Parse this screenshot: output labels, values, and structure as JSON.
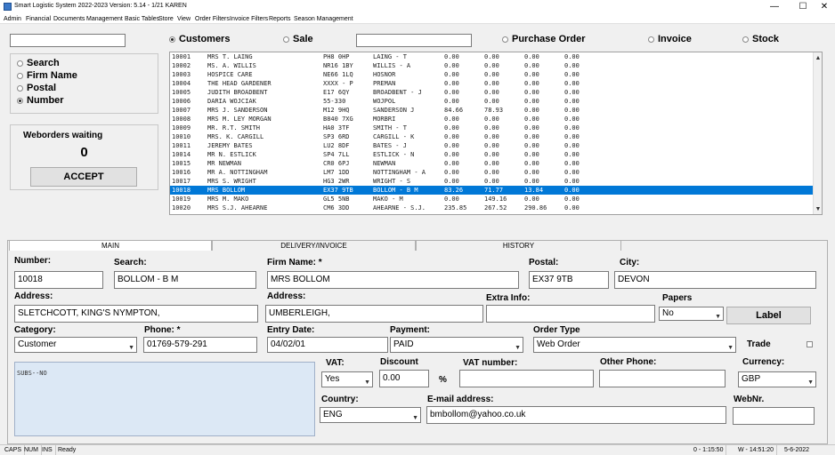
{
  "window": {
    "title": "Smart Logistic System 2022-2023   Version: 5.14 - 1/21 KAREN",
    "minimize": "—",
    "maximize": "☐",
    "close": "✕"
  },
  "menu": [
    "Admin",
    "Financial",
    "Documents",
    "Management",
    "Basic Tables",
    "Store",
    "View",
    "Order Filters",
    "Invoice Filters",
    "Reports",
    "Season Management"
  ],
  "top": {
    "search_value": "",
    "sale_search_value": "",
    "radios": [
      {
        "label": "Customers",
        "checked": true
      },
      {
        "label": "Sale",
        "checked": false
      },
      {
        "label": "Purchase Order",
        "checked": false
      },
      {
        "label": "Invoice",
        "checked": false
      },
      {
        "label": "Stock",
        "checked": false
      }
    ]
  },
  "search_mode": [
    {
      "label": "Search",
      "checked": false
    },
    {
      "label": "Firm Name",
      "checked": false
    },
    {
      "label": "Postal",
      "checked": false
    },
    {
      "label": "Number",
      "checked": true
    }
  ],
  "weborders": {
    "label": "Weborders waiting",
    "count": "0",
    "accept_label": "ACCEPT"
  },
  "customers": [
    [
      "10001",
      "MRS T. LAING",
      "PH8 0HP",
      "LAING - T",
      "0.00",
      "0.00",
      "0.00",
      "0.00"
    ],
    [
      "10002",
      "MS. A. WILLIS",
      "NR16 1BY",
      "WILLIS - A",
      "0.00",
      "0.00",
      "0.00",
      "0.00"
    ],
    [
      "10003",
      "HOSPICE CARE",
      "NE66 1LQ",
      "HOSNOR",
      "0.00",
      "0.00",
      "0.00",
      "0.00"
    ],
    [
      "10004",
      "THE HEAD GARDENER",
      "XXXX - P",
      "PREMAN",
      "0.00",
      "0.00",
      "0.00",
      "0.00"
    ],
    [
      "10005",
      "JUDITH BROADBENT",
      "E17 6QY",
      "BROADBENT - J",
      "0.00",
      "0.00",
      "0.00",
      "0.00"
    ],
    [
      "10006",
      "DARIA WOJCIAK",
      "55-330",
      "WOJPOL",
      "0.00",
      "0.00",
      "0.00",
      "0.00"
    ],
    [
      "10007",
      "MRS J. SANDERSON",
      "M12 9HQ",
      "SANDERSON  J",
      "84.66",
      "78.93",
      "0.00",
      "0.00"
    ],
    [
      "10008",
      "MRS M. LEY MORGAN",
      "B840 7XG",
      "MORBRI",
      "0.00",
      "0.00",
      "0.00",
      "0.00"
    ],
    [
      "10009",
      "MR. R.T. SMITH",
      "HA0 3TF",
      "SMITH - T",
      "0.00",
      "0.00",
      "0.00",
      "0.00"
    ],
    [
      "10010",
      "MRS. K. CARGILL",
      "SP3 6RD",
      "CARGILL - K",
      "0.00",
      "0.00",
      "0.00",
      "0.00"
    ],
    [
      "10011",
      "JEREMY BATES",
      "LU2 8DF",
      "BATES - J",
      "0.00",
      "0.00",
      "0.00",
      "0.00"
    ],
    [
      "10014",
      "MR N. ESTLICK",
      "SP4 7LL",
      "ESTLICK - N",
      "0.00",
      "0.00",
      "0.00",
      "0.00"
    ],
    [
      "10015",
      "MR NEWMAN",
      "CR0 6PJ",
      "NEWMAN",
      "0.00",
      "0.00",
      "0.00",
      "0.00"
    ],
    [
      "10016",
      "MR A. NOTTINGHAM",
      "LM7 1DD",
      "NOTTINGHAM - A",
      "0.00",
      "0.00",
      "0.00",
      "0.00"
    ],
    [
      "10017",
      "MRS S. WRIGHT",
      "HG3 2WR",
      "WRIGHT - S",
      "0.00",
      "0.00",
      "0.00",
      "0.00"
    ],
    [
      "10018",
      "MRS BOLLOM",
      "EX37 9TB",
      "BOLLOM - B M",
      "83.26",
      "71.77",
      "13.84",
      "0.00"
    ],
    [
      "10019",
      "MRS M. MAKO",
      "GL5 5NB",
      "MAKO - M",
      "0.00",
      "149.16",
      "0.00",
      "0.00"
    ],
    [
      "10020",
      "MRS S.J. AHEARNE",
      "CM6 3DD",
      "AHEARNE - S.J.",
      "235.85",
      "267.52",
      "290.86",
      "0.00"
    ]
  ],
  "selected_index": 15,
  "tabs": [
    "MAIN",
    "DELIVERY/INVOICE",
    "HISTORY"
  ],
  "form": {
    "number_label": "Number:",
    "number": "10018",
    "search_label": "Search:",
    "search": "BOLLOM - B M",
    "firm_label": "Firm Name: *",
    "firm": "MRS BOLLOM",
    "postal_label": "Postal:",
    "postal": "EX37 9TB",
    "city_label": "City:",
    "city": "DEVON",
    "address_label": "Address:",
    "address1": "SLETCHCOTT,   KING'S NYMPTON,",
    "address2_label": "Address:",
    "address2": "UMBERLEIGH,",
    "extra_label": "Extra Info:",
    "extra": "",
    "papers_label": "Papers",
    "papers": "No",
    "label_button": "Label",
    "category_label": "Category:",
    "category": "Customer",
    "phone_label": "Phone: *",
    "phone": "01769-579-291",
    "entry_label": "Entry Date:",
    "entry": "04/02/01",
    "payment_label": "Payment:",
    "payment": "PAID",
    "order_type_label": "Order Type",
    "order_type": "Web Order",
    "trade_label": "Trade",
    "notes": "SUBS--NO",
    "vat_label": "VAT:",
    "vat": "Yes",
    "discount_label": "Discount",
    "discount": "0.00",
    "percent": "%",
    "vat_number_label": "VAT number:",
    "vat_number": "",
    "other_phone_label": "Other Phone:",
    "other_phone": "",
    "currency_label": "Currency:",
    "currency": "GBP",
    "country_label": "Country:",
    "country": "ENG",
    "email_label": "E-mail address:",
    "email": "bmbollom@yahoo.co.uk",
    "webnr_label": "WebNr.",
    "webnr": ""
  },
  "status": {
    "caps": "CAPS",
    "num": "NUM",
    "ins": "INS",
    "ready": "Ready",
    "pos1": "0 - 1:15:50",
    "pos2": "W - 14:51:20",
    "date": "5-6-2022"
  }
}
